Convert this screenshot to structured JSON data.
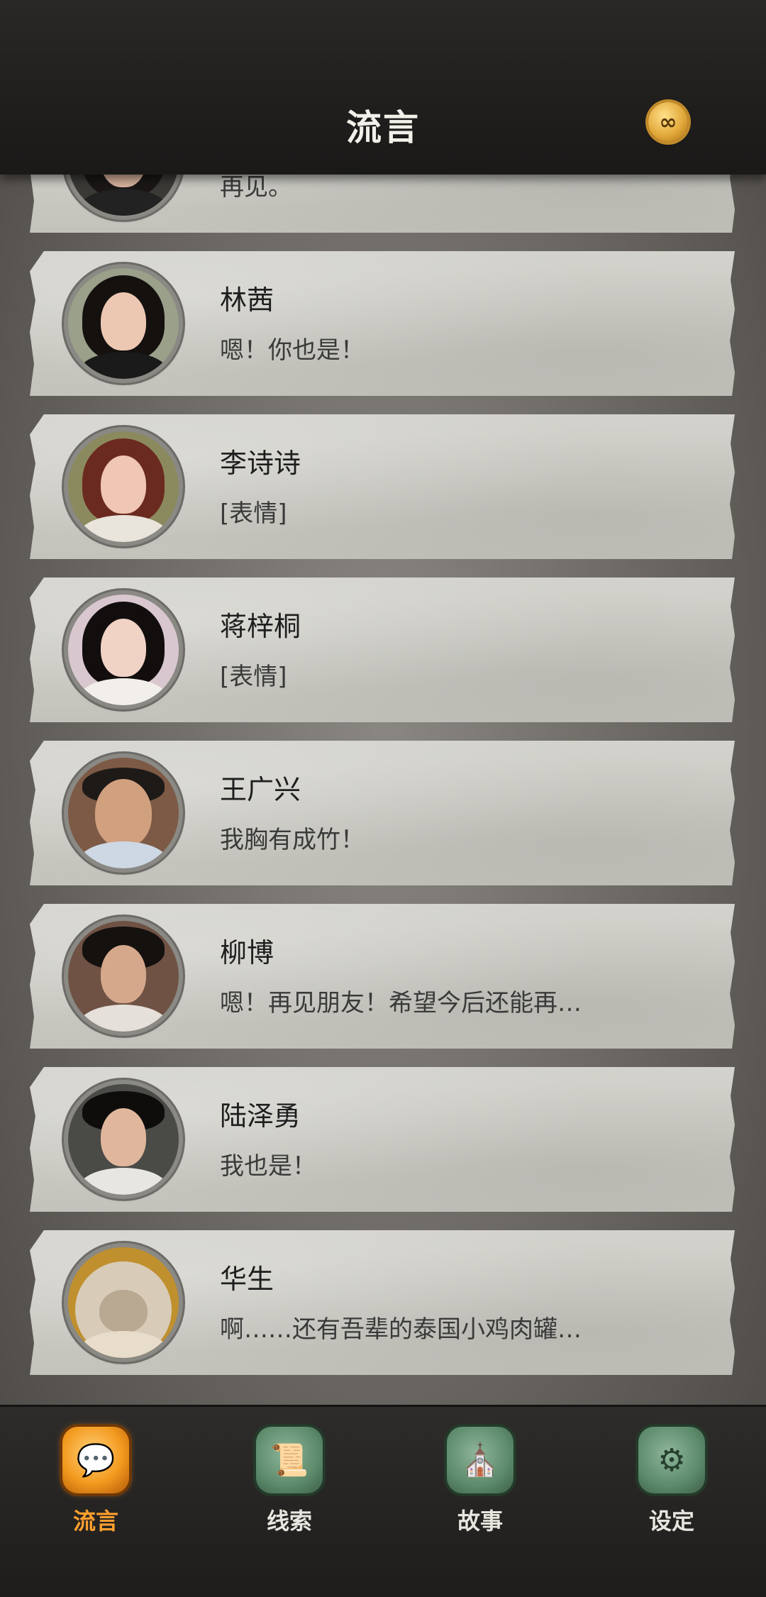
{
  "header": {
    "title": "流言",
    "badge_icon": "infinity-icon",
    "badge_symbol": "∞"
  },
  "contacts": [
    {
      "name": "",
      "message": "再见。",
      "avatar": "avatar-woman-dark-hair"
    },
    {
      "name": "林茜",
      "message": "嗯！你也是！",
      "avatar": "avatar-woman-long-black-hair"
    },
    {
      "name": "李诗诗",
      "message": "[表情]",
      "avatar": "avatar-woman-auburn-hair-cat-ears"
    },
    {
      "name": "蒋梓桐",
      "message": "[表情]",
      "avatar": "avatar-woman-black-hair"
    },
    {
      "name": "王广兴",
      "message": "我胸有成竹！",
      "avatar": "avatar-man-glasses-beard"
    },
    {
      "name": "柳博",
      "message": "嗯！再见朋友！希望今后还能再…",
      "avatar": "avatar-man-slick-hair"
    },
    {
      "name": "陆泽勇",
      "message": "我也是！",
      "avatar": "avatar-man-glasses"
    },
    {
      "name": "华生",
      "message": "啊……还有吾辈的泰国小鸡肉罐…",
      "avatar": "avatar-cat"
    }
  ],
  "tabs": [
    {
      "label": "流言",
      "icon": "chat-bubble-icon",
      "glyph": "💬",
      "active": true
    },
    {
      "label": "线索",
      "icon": "scroll-icon",
      "glyph": "📜",
      "active": false
    },
    {
      "label": "故事",
      "icon": "church-icon",
      "glyph": "⛪",
      "active": false
    },
    {
      "label": "设定",
      "icon": "gear-icon",
      "glyph": "⚙",
      "active": false
    }
  ],
  "colors": {
    "accent": "#ff9f2e",
    "card": "#cfcec8",
    "header": "#1f1d1c"
  }
}
